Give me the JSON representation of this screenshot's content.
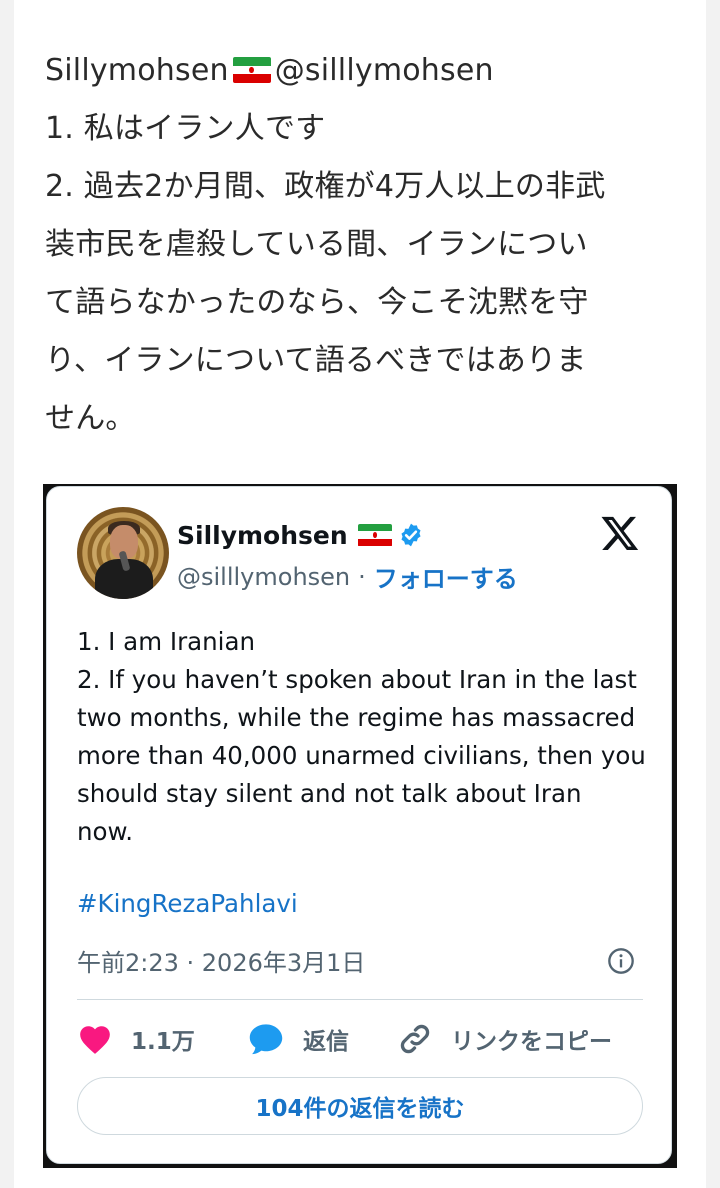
{
  "post": {
    "author_name": "Sillymohsen",
    "author_handle": "@silllymohsen",
    "lines": [
      "1. 私はイラン人です",
      "2. 過去2か月間、政権が4万人以上の非武",
      "装市民を虐殺している間、イランについ",
      "て語らなかったのなら、今こそ沈黙を守",
      "り、イランについて語るべきではありま",
      "せん。"
    ]
  },
  "tweet": {
    "name": "Sillymohsen",
    "handle": "@silllymohsen",
    "separator": "·",
    "follow_label": "フォローする",
    "body_lines": [
      "1. I am Iranian",
      "2. If you haven’t spoken about Iran in the last",
      "two months, while the regime has massacred",
      "more than 40,000 unarmed civilians, then you",
      "should stay silent and not talk about Iran",
      "now."
    ],
    "hashtag": "#KingRezaPahlavi",
    "timestamp": "午前2:23 · 2026年3月1日",
    "likes": "1.1万",
    "reply_label": "返信",
    "copy_link_label": "リンクをコピー",
    "read_replies_label": "104件の返信を読む"
  },
  "colors": {
    "accent": "#1773c7",
    "like_heart": "#f91880",
    "reply_bubble": "#1d9bf0",
    "flag_green": "#239f40",
    "flag_red": "#da0000"
  },
  "icons": [
    "iran-flag-icon",
    "verified-badge-icon",
    "x-logo-icon",
    "info-icon",
    "heart-icon",
    "reply-icon",
    "link-icon"
  ]
}
